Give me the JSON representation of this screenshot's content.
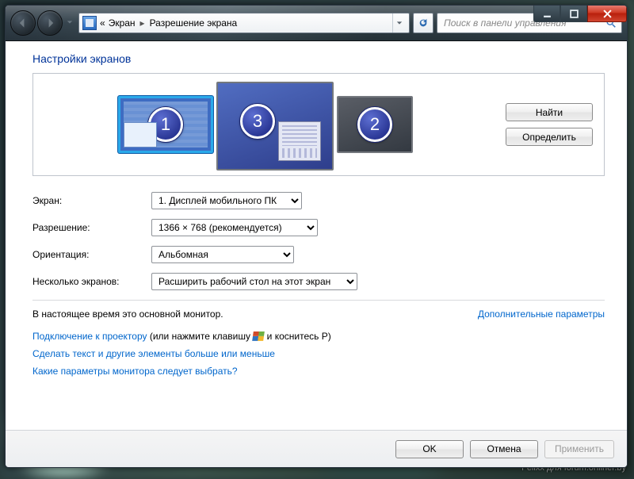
{
  "breadcrumb": {
    "chevrons": "«",
    "item1": "Экран",
    "item2": "Разрешение экрана"
  },
  "search": {
    "placeholder": "Поиск в панели управления"
  },
  "page_title": "Настройки экранов",
  "monitors": {
    "n1": "1",
    "n2": "2",
    "n3": "3"
  },
  "side": {
    "find": "Найти",
    "identify": "Определить"
  },
  "rows": {
    "screen_lbl": "Экран:",
    "screen_val": "1. Дисплей мобильного ПК",
    "res_lbl": "Разрешение:",
    "res_val": "1366 × 768 (рекомендуется)",
    "orient_lbl": "Ориентация:",
    "orient_val": "Альбомная",
    "multi_lbl": "Несколько экранов:",
    "multi_val": "Расширить рабочий стол на этот экран"
  },
  "status": {
    "main_monitor": "В настоящее время это основной монитор.",
    "advanced": "Дополнительные параметры"
  },
  "help": {
    "projector_link": "Подключение к проектору",
    "projector_tail_a": " (или нажмите клавишу ",
    "projector_tail_b": " и коснитесь P)",
    "textsize": "Сделать текст и другие элементы больше или меньше",
    "which": "Какие параметры монитора следует выбрать?"
  },
  "footer": {
    "ok": "OK",
    "cancel": "Отмена",
    "apply": "Применить"
  },
  "watermark": "Felixx для forum.onliner.by"
}
